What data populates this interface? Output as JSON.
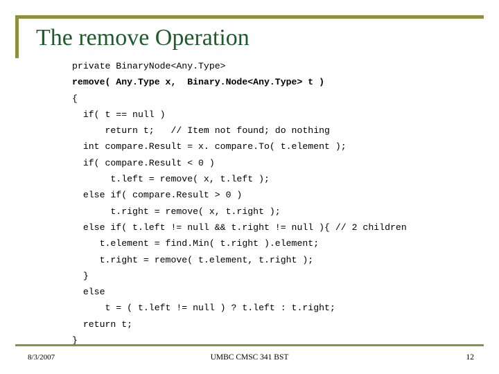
{
  "slide": {
    "title": "The remove Operation",
    "title_color": "#1d5b2a",
    "accent_color": "#8f8f3f",
    "code_lines": [
      {
        "text": "private BinaryNode<Any.Type>",
        "bold": false
      },
      {
        "text": "remove( Any.Type x,  Binary.Node<Any.Type> t )",
        "bold": true
      },
      {
        "text": "{",
        "bold": false
      },
      {
        "text": "  if( t == null )",
        "bold": false
      },
      {
        "text": "      return t;   // Item not found; do nothing",
        "bold": false
      },
      {
        "text": "  int compare.Result = x. compare.To( t.element );",
        "bold": false
      },
      {
        "text": "  if( compare.Result < 0 )",
        "bold": false
      },
      {
        "text": "       t.left = remove( x, t.left );",
        "bold": false
      },
      {
        "text": "  else if( compare.Result > 0 )",
        "bold": false
      },
      {
        "text": "       t.right = remove( x, t.right );",
        "bold": false
      },
      {
        "text": "  else if( t.left != null && t.right != null ){ // 2 children",
        "bold": false
      },
      {
        "text": "     t.element = find.Min( t.right ).element;",
        "bold": false
      },
      {
        "text": "     t.right = remove( t.element, t.right );",
        "bold": false
      },
      {
        "text": "  }",
        "bold": false
      },
      {
        "text": "  else",
        "bold": false
      },
      {
        "text": "      t = ( t.left != null ) ? t.left : t.right;",
        "bold": false
      },
      {
        "text": "  return t;",
        "bold": false
      },
      {
        "text": "}",
        "bold": false
      }
    ]
  },
  "footer": {
    "date": "8/3/2007",
    "center": "UMBC CMSC 341 BST",
    "page": "12"
  }
}
